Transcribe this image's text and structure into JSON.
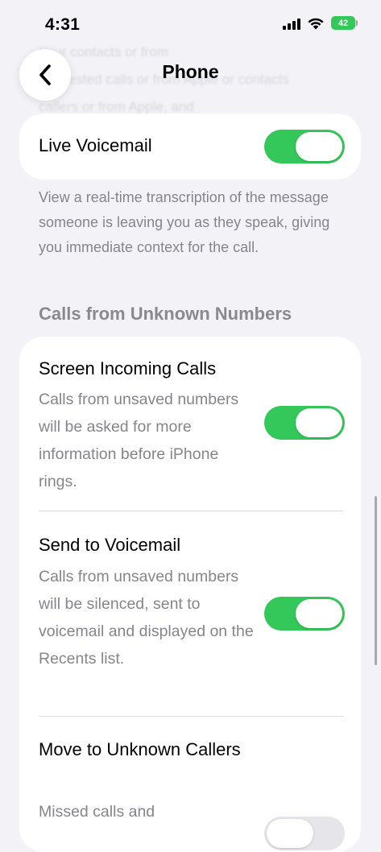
{
  "status_bar": {
    "time": "4:31",
    "battery": "42",
    "icons": [
      "signal-icon",
      "wifi-icon",
      "battery-icon"
    ]
  },
  "faded_text": "Your contacts or from\nsuggested calls or from Apple or contacts\ncallers or from Apple, and",
  "nav": {
    "back_icon": "chevron-left-icon",
    "title": "Phone"
  },
  "live_voicemail": {
    "label": "Live Voicemail",
    "enabled": true,
    "footer": "View a real-time transcription of the message someone is leaving you as they speak, giving you immediate context for the call."
  },
  "unknown_numbers": {
    "header": "Calls from Unknown Numbers",
    "options": [
      {
        "label": "Screen Incoming Calls",
        "description": "Calls from unsaved numbers will be asked for more information before iPhone rings.",
        "enabled": true
      },
      {
        "label": "Send to Voicemail",
        "description": "Calls from unsaved numbers will be silenced, sent to voicemail and displayed on the Recents list.",
        "enabled": true
      },
      {
        "label": "Move to Unknown Callers",
        "description": "Missed calls and",
        "enabled": false
      }
    ]
  },
  "colors": {
    "accent_green": "#34c759",
    "background": "#f2f2f7",
    "secondary_text": "#85858b"
  }
}
